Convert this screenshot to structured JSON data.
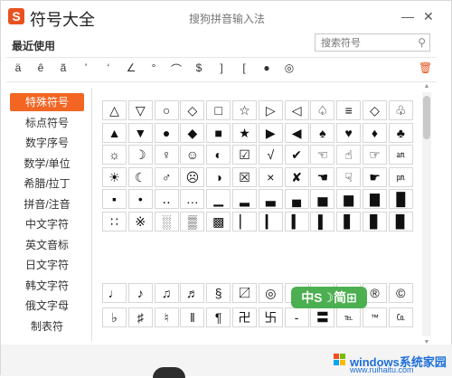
{
  "titlebar": {
    "logo": "S",
    "title": "符号大全",
    "subtitle": "搜狗拼音输入法"
  },
  "recent": {
    "label": "最近使用",
    "symbols": [
      "ä",
      "ê",
      "ã",
      "’",
      "‘",
      "∠",
      "°",
      "⌒",
      "$",
      "]",
      "[",
      "●",
      "◎"
    ]
  },
  "search": {
    "placeholder": "搜索符号"
  },
  "sidebar": {
    "items": [
      {
        "label": "特殊符号",
        "active": true
      },
      {
        "label": "标点符号"
      },
      {
        "label": "数字序号"
      },
      {
        "label": "数学/单位"
      },
      {
        "label": "希腊/拉丁"
      },
      {
        "label": "拼音/注音"
      },
      {
        "label": "中文字符"
      },
      {
        "label": "英文音标"
      },
      {
        "label": "日文字符"
      },
      {
        "label": "韩文字符"
      },
      {
        "label": "俄文字母"
      },
      {
        "label": "制表符"
      }
    ]
  },
  "grid1": [
    [
      "△",
      "▽",
      "○",
      "◇",
      "□",
      "☆",
      "▷",
      "◁",
      "♤",
      "≡",
      "◇",
      "♧"
    ],
    [
      "▲",
      "▼",
      "●",
      "◆",
      "■",
      "★",
      "▶",
      "◀",
      "♠",
      "♥",
      "♦",
      "♣"
    ],
    [
      "☼",
      "☽",
      "♀",
      "☺",
      "◐",
      "☑",
      "√",
      "✔",
      "☜",
      "☝",
      "☞",
      "㏂"
    ],
    [
      "☀",
      "☾",
      "♂",
      "☹",
      "◑",
      "☒",
      "×",
      "✘",
      "☚",
      "☟",
      "☛",
      "㏘"
    ],
    [
      "▪",
      "•",
      "‥",
      "…",
      "▁",
      "▂",
      "▃",
      "▄",
      "▅",
      "▆",
      "▇",
      "█"
    ],
    [
      "∷",
      "※",
      "░",
      "▒",
      "▩",
      "▏",
      "▎",
      "▍",
      "▌",
      "▋",
      "▊",
      "▉"
    ]
  ],
  "grid2": [
    [
      "♩",
      "♪",
      "♫",
      "♬",
      "§",
      "〼",
      "◎",
      "¤",
      "۞",
      "℗",
      "®",
      "©"
    ],
    [
      "♭",
      "♯",
      "♮",
      "‖",
      "¶",
      "卍",
      "卐",
      "‐",
      "〓",
      "℡",
      "™",
      "㏇"
    ]
  ],
  "overlay": {
    "text": "中S☽简⊞"
  },
  "watermark": {
    "name": "windows系统家园",
    "url": "www.ruihaitu.com"
  },
  "colors": {
    "accent": "#f26522",
    "logo": "#e8511f",
    "badge": "#4caf50",
    "watermark": "#1e6fd9"
  }
}
